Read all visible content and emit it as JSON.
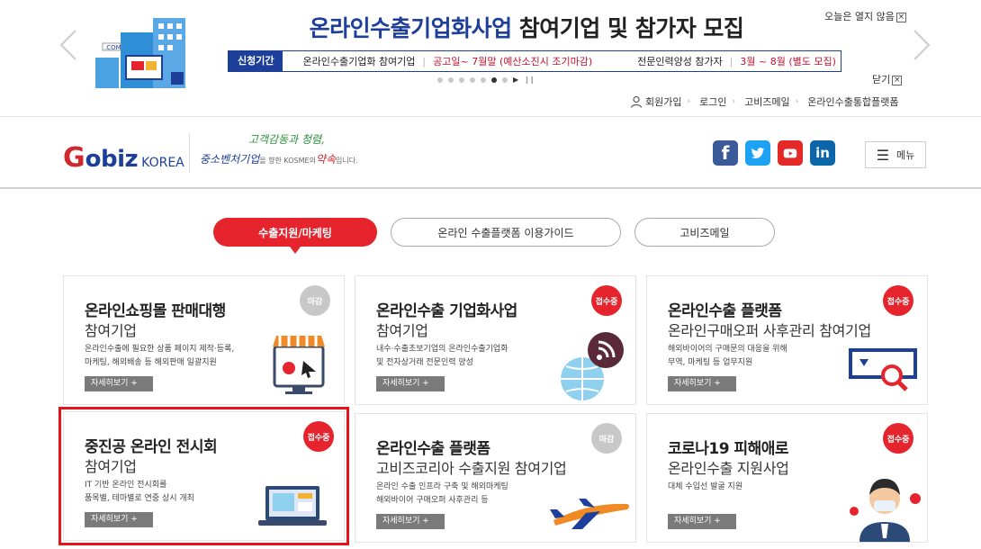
{
  "banner": {
    "title_part1": "온라인수출기업화사업",
    "title_part2": "참여기업 및 참가자 모집",
    "period_label": "신청기간",
    "item1_name": "온라인수출기업화 참여기업",
    "item1_period": "공고일~ 7월말 (예산소진시 조기마감)",
    "item2_name": "전문인력양성 참가자",
    "item2_period": "3월 ~ 8월 (별도 모집)",
    "today_close": "오늘은 열지 않음",
    "close": "닫기",
    "checkbox_mark": "×",
    "slide_count": 7,
    "active_slide": 6,
    "colors": {
      "brand_blue": "#1d3f9a",
      "accent_red": "#c0122c"
    }
  },
  "util_nav": {
    "items": [
      "회원가입",
      "로그인",
      "고비즈메일",
      "온라인수출통합플랫폼"
    ]
  },
  "header": {
    "logo_g": "G",
    "logo_biz": "obiz",
    "logo_korea": "KOREA",
    "slogan_line1": "고객감동과 청렴,",
    "slogan_line2_a": "중소벤처기업",
    "slogan_line2_b": "을 향한 KOSME의",
    "slogan_line2_c": "약속",
    "slogan_line2_d": "입니다.",
    "sns": [
      "facebook-icon",
      "twitter-icon",
      "youtube-icon",
      "linkedin-icon"
    ],
    "menu_label": "메뉴"
  },
  "tabs": [
    {
      "label": "수출지원/마케팅",
      "active": true
    },
    {
      "label": "온라인 수출플랫폼 이용가이드",
      "active": false
    },
    {
      "label": "고비즈메일",
      "active": false
    }
  ],
  "cards": [
    {
      "title": "온라인쇼핑몰 판매대행",
      "sub": "참여기업",
      "desc1": "온라인수출에 필요한 상품 페이지 제작·등록,",
      "desc2": "마케팅, 해외배송 등 해외판매 일괄지원",
      "more": "자세히보기 +",
      "badge": "마감",
      "status": "closed"
    },
    {
      "title": "온라인수출 기업화사업",
      "sub": "참여기업",
      "desc1": "내수·수출초보기업의 온라인수출기업화",
      "desc2": "및 전자상거래 전문인력 양성",
      "more": "자세히보기 +",
      "badge": "접수중",
      "status": "open"
    },
    {
      "title": "온라인수출 플랫폼",
      "sub": "온라인구매오퍼 사후관리 참여기업",
      "desc1": "해외바이어의 구매문의 대응을 위해",
      "desc2": "무역, 마케팅 등 업무지원",
      "more": "자세히보기 +",
      "badge": "접수중",
      "status": "open"
    },
    {
      "title": "중진공 온라인 전시회",
      "sub": "참여기업",
      "desc1": "IT 기반 온라인 전시회를",
      "desc2": "품목별, 테마별로 연중 상시 개최",
      "more": "자세히보기 +",
      "badge": "접수중",
      "status": "open"
    },
    {
      "title": "온라인수출 플랫폼",
      "sub": "고비즈코리아 수출지원 참여기업",
      "desc1": "온라인 수출 인프라 구축 및 해외마케팅",
      "desc2": "해외바이어 구매오퍼 사후관리 등",
      "more": "자세히보기 +",
      "badge": "마감",
      "status": "closed"
    },
    {
      "title": "코로나19 피해애로",
      "sub": "온라인수출 지원사업",
      "desc1": "대체 수입선 발굴 지원",
      "desc2": "",
      "more": "자세히보기 +",
      "badge": "접수중",
      "status": "open"
    }
  ]
}
